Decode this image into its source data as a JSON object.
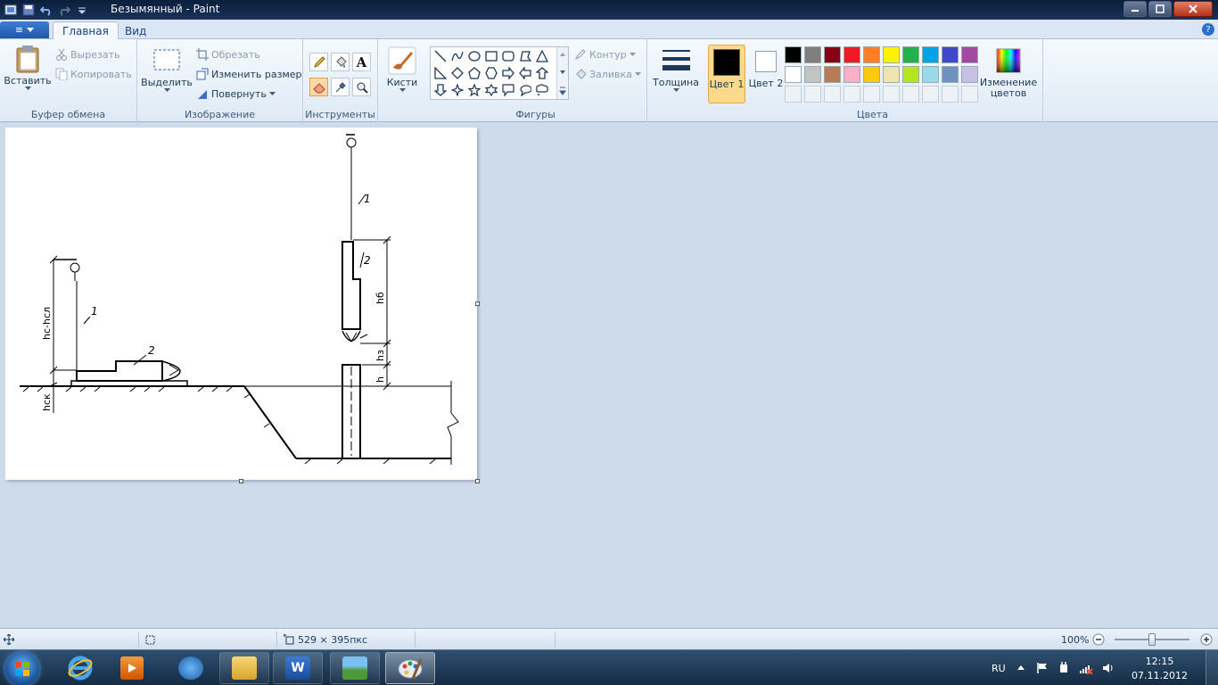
{
  "window": {
    "title": "Безымянный - Paint",
    "controls": [
      "minimize",
      "maximize",
      "close"
    ]
  },
  "quick_access": {
    "icons": [
      "app-icon",
      "save-icon",
      "undo-icon",
      "redo-icon",
      "customize-icon"
    ]
  },
  "tabs": {
    "menu_label": "≡",
    "items": [
      {
        "label": "Главная",
        "active": true
      },
      {
        "label": "Вид",
        "active": false
      }
    ]
  },
  "ribbon": {
    "clipboard": {
      "group_label": "Буфер обмена",
      "paste": "Вставить",
      "cut": "Вырезать",
      "copy": "Копировать"
    },
    "image": {
      "group_label": "Изображение",
      "select": "Выделить",
      "crop": "Обрезать",
      "resize": "Изменить размер",
      "rotate": "Повернуть"
    },
    "tools": {
      "group_label": "Инструменты",
      "items": [
        "pencil-icon",
        "fill-icon",
        "text-icon",
        "eraser-icon",
        "color-picker-icon",
        "magnifier-icon"
      ],
      "text_glyph": "A"
    },
    "brushes": {
      "label": "Кисти"
    },
    "shapes": {
      "group_label": "Фигуры",
      "outline": "Контур",
      "fill": "Заливка"
    },
    "size": {
      "label": "Толщина"
    },
    "colors": {
      "group_label": "Цвета",
      "color1_label": "Цвет 1",
      "color2_label": "Цвет 2",
      "color1": "#000000",
      "color2": "#ffffff",
      "edit_label": "Изменение цветов",
      "palette_row1": [
        "#000000",
        "#7f7f7f",
        "#880015",
        "#ed1c24",
        "#ff7f27",
        "#fff200",
        "#22b14c",
        "#00a2e8",
        "#3f48cc",
        "#a349a4"
      ],
      "palette_row2": [
        "#ffffff",
        "#c3c3c3",
        "#b97a57",
        "#ffaec9",
        "#ffc90e",
        "#efe4b0",
        "#b5e61d",
        "#99d9ea",
        "#7092be",
        "#c8bfe7"
      ]
    }
  },
  "drawing": {
    "labels": {
      "leader_1a": "1",
      "leader_2a": "2",
      "leader_1b": "1",
      "leader_2b": "2",
      "dim_hc_hsl": "hc-hсл",
      "dim_hsk": "hск",
      "dim_hb": "hб",
      "dim_hz": "hз",
      "dim_h": "h"
    }
  },
  "statusbar": {
    "canvas_size": "529 × 395пкс",
    "zoom": "100%"
  },
  "taskbar": {
    "apps": [
      "internet-explorer-icon",
      "media-player-icon",
      "app3-icon",
      "explorer-icon",
      "word-icon",
      "image-viewer-icon",
      "paint-icon"
    ],
    "word_glyph": "W",
    "lang": "RU",
    "time": "12:15",
    "date": "07.11.2012"
  }
}
